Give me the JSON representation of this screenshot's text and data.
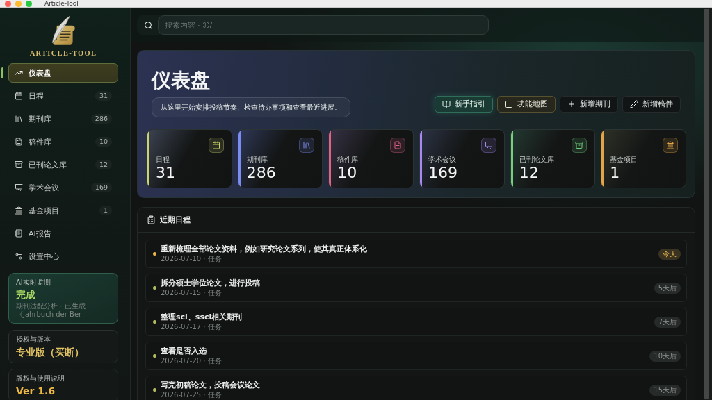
{
  "window": {
    "title": "Article-Tool"
  },
  "sidebar": {
    "brand": "ARTICLE-TOOL",
    "items": [
      {
        "label": "仪表盘",
        "selected": true
      },
      {
        "label": "日程",
        "count": "31",
        "selected": false
      },
      {
        "label": "期刊库",
        "count": "286",
        "selected": false
      },
      {
        "label": "稿件库",
        "count": "10",
        "selected": false
      },
      {
        "label": "已刊论文库",
        "count": "12",
        "selected": false
      },
      {
        "label": "学术会议",
        "count": "169",
        "selected": false
      },
      {
        "label": "基金项目",
        "count": "1",
        "selected": false
      },
      {
        "label": "AI报告",
        "selected": false
      },
      {
        "label": "设置中心",
        "selected": false
      }
    ],
    "monitor": {
      "label": "AI实时监测",
      "status": "完成",
      "detail": "期刊适配分析 · 已生成《Jahrbuch der Ber"
    },
    "license": {
      "label": "授权与版本",
      "value": "专业版（买断）"
    },
    "about": {
      "label": "版权与使用说明",
      "value": "Ver 1.6"
    }
  },
  "search": {
    "placeholder": "搜索内容 · ⌘/"
  },
  "hero": {
    "title": "仪表盘",
    "subtitle": "从这里开始安排投稿节奏、检查待办事项和查看最近进展。",
    "actions": [
      {
        "label": "新手指引",
        "kind": "guide"
      },
      {
        "label": "功能地图",
        "kind": "map"
      },
      {
        "label": "新增期刊",
        "kind": "plain"
      },
      {
        "label": "新增稿件",
        "kind": "plain"
      }
    ]
  },
  "stats": [
    {
      "label": "日程",
      "value": "31",
      "color": "#c9d46c"
    },
    {
      "label": "期刊库",
      "value": "286",
      "color": "#7c8cf2"
    },
    {
      "label": "稿件库",
      "value": "10",
      "color": "#e0628a"
    },
    {
      "label": "学术会议",
      "value": "169",
      "color": "#a68af0"
    },
    {
      "label": "已刊论文库",
      "value": "12",
      "color": "#72d07e"
    },
    {
      "label": "基金项目",
      "value": "1",
      "color": "#e2a446"
    }
  ],
  "schedule": {
    "title": "近期日程",
    "items": [
      {
        "title": "重新梳理全部论文资料，例如研究论文系列，使其真正体系化",
        "meta": "2026-07-10 · 任务",
        "due": "今天",
        "kind": "today",
        "color": "#e8b448"
      },
      {
        "title": "拆分硕士学位论文，进行投稿",
        "meta": "2026-07-15 · 任务",
        "due": "5天后",
        "kind": "upcoming",
        "color": "#b4bc62"
      },
      {
        "title": "整理sci、ssci相关期刊",
        "meta": "2026-07-17 · 任务",
        "due": "7天后",
        "kind": "upcoming",
        "color": "#b4bc62"
      },
      {
        "title": "查看是否入选",
        "meta": "2026-07-20 · 任务",
        "due": "10天后",
        "kind": "upcoming",
        "color": "#b4bc62"
      },
      {
        "title": "写完初稿论文，投稿会议论文",
        "meta": "2026-07-25 · 任务",
        "due": "15天后",
        "kind": "upcoming",
        "color": "#b4bc62"
      }
    ]
  }
}
